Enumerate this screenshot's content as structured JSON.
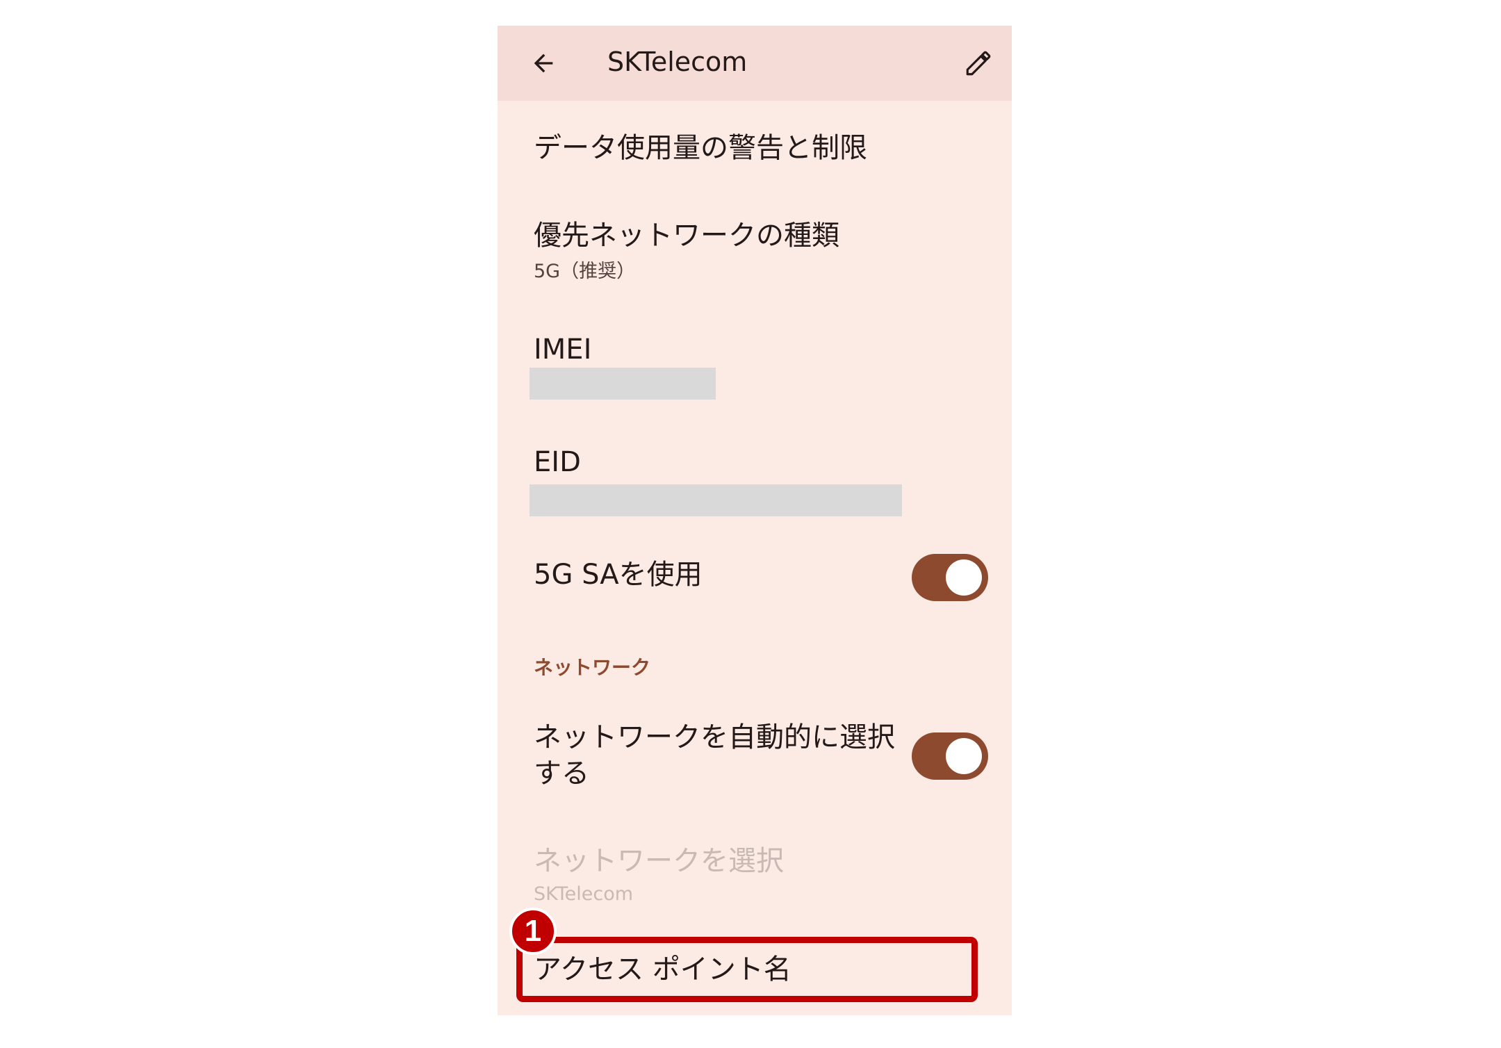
{
  "colors": {
    "background": "#fceae4",
    "appbar": "#f6dcd6",
    "accent": "#8e4a2e",
    "annotation": "#c00000"
  },
  "appbar": {
    "back_icon": "arrow-back-icon",
    "title": "SKTelecom",
    "edit_icon": "pencil-icon"
  },
  "settings": {
    "data_usage": {
      "title": "データ使用量の警告と制限"
    },
    "preferred_network": {
      "title": "優先ネットワークの種類",
      "value": "5G（推奨）"
    },
    "imei": {
      "title": "IMEI"
    },
    "eid": {
      "title": "EID"
    },
    "use_5g_sa": {
      "title": "5G SAを使用",
      "enabled": true
    }
  },
  "network_section": {
    "header": "ネットワーク",
    "auto_select": {
      "title": "ネットワークを自動的に選択する",
      "enabled": true
    },
    "select_network": {
      "title": "ネットワークを選択",
      "value": "SKTelecom",
      "disabled": true
    },
    "apn": {
      "title": "アクセス ポイント名"
    }
  },
  "annotation": {
    "step_number": "1"
  }
}
